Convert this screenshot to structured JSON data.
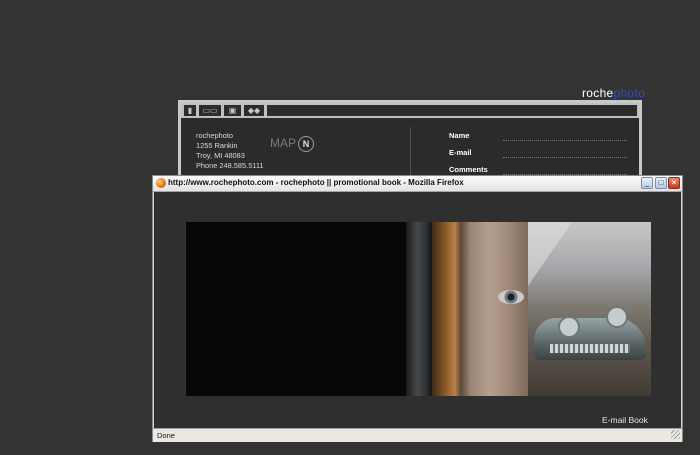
{
  "site": {
    "logo_part1": "roche",
    "logo_part2": "photo",
    "contact": {
      "name": "rochephoto",
      "street": "1255 Rankin",
      "city": "Troy, MI 48083",
      "phone": "Phone 248.585.5111"
    },
    "map_label": "MAP",
    "compass_letter": "N",
    "form": {
      "name_label": "Name",
      "email_label": "E-mail",
      "comments_label": "Comments"
    }
  },
  "window": {
    "title": "http://www.rochephoto.com - rochephoto || promotional book - Mozilla Firefox",
    "controls": {
      "minimize": "_",
      "maximize": "□",
      "close": "×"
    },
    "email_book_link": "E-mail Book",
    "status_text": "Done"
  },
  "colors": {
    "page_background": "#333333",
    "logo_accent": "#2e4fd0",
    "close_button": "#c83a1d"
  },
  "icons": [
    "firefox-icon",
    "compass-icon",
    "resize-grip-icon"
  ]
}
